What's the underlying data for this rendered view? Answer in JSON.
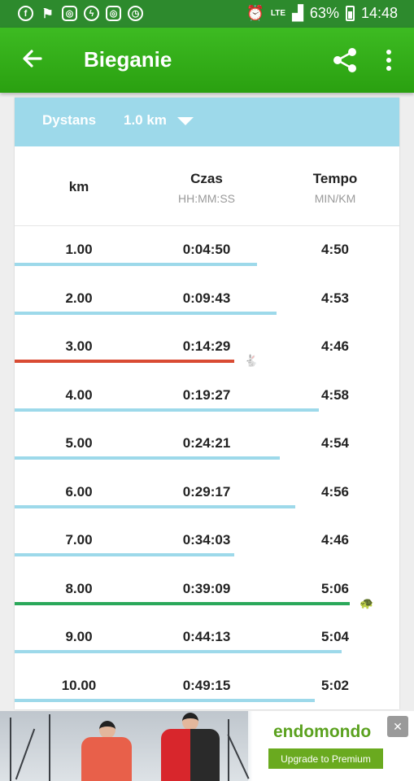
{
  "statusbar": {
    "icons": [
      "facebook-icon",
      "flag-icon",
      "instagram-icon",
      "messenger-icon",
      "instagram-icon",
      "alarm-icon"
    ],
    "lte": "LTE",
    "battery": "63%",
    "time": "14:48"
  },
  "toolbar": {
    "title": "Bieganie"
  },
  "distance": {
    "label": "Dystans",
    "value": "1.0 km"
  },
  "header": {
    "km": "km",
    "time": "Czas",
    "time_unit": "HH:MM:SS",
    "pace": "Tempo",
    "pace_unit": "MIN/KM"
  },
  "splits": [
    {
      "km": "1.00",
      "time": "0:04:50",
      "pace": "4:50",
      "bar_fraction": 0.63,
      "marker": ""
    },
    {
      "km": "2.00",
      "time": "0:09:43",
      "pace": "4:53",
      "bar_fraction": 0.68,
      "marker": ""
    },
    {
      "km": "3.00",
      "time": "0:14:29",
      "pace": "4:46",
      "bar_fraction": 0.57,
      "marker": "fastest"
    },
    {
      "km": "4.00",
      "time": "0:19:27",
      "pace": "4:58",
      "bar_fraction": 0.79,
      "marker": ""
    },
    {
      "km": "5.00",
      "time": "0:24:21",
      "pace": "4:54",
      "bar_fraction": 0.69,
      "marker": ""
    },
    {
      "km": "6.00",
      "time": "0:29:17",
      "pace": "4:56",
      "bar_fraction": 0.73,
      "marker": ""
    },
    {
      "km": "7.00",
      "time": "0:34:03",
      "pace": "4:46",
      "bar_fraction": 0.57,
      "marker": ""
    },
    {
      "km": "8.00",
      "time": "0:39:09",
      "pace": "5:06",
      "bar_fraction": 0.87,
      "marker": "slowest"
    },
    {
      "km": "9.00",
      "time": "0:44:13",
      "pace": "5:04",
      "bar_fraction": 0.85,
      "marker": ""
    },
    {
      "km": "10.00",
      "time": "0:49:15",
      "pace": "5:02",
      "bar_fraction": 0.78,
      "marker": ""
    }
  ],
  "colors": {
    "bar": "#9dd9ea",
    "fastest": "#d94b33",
    "slowest": "#2aa85a",
    "toolbar": "#2faa14"
  },
  "ad": {
    "brand": "endomondo",
    "button": "Upgrade to Premium"
  }
}
